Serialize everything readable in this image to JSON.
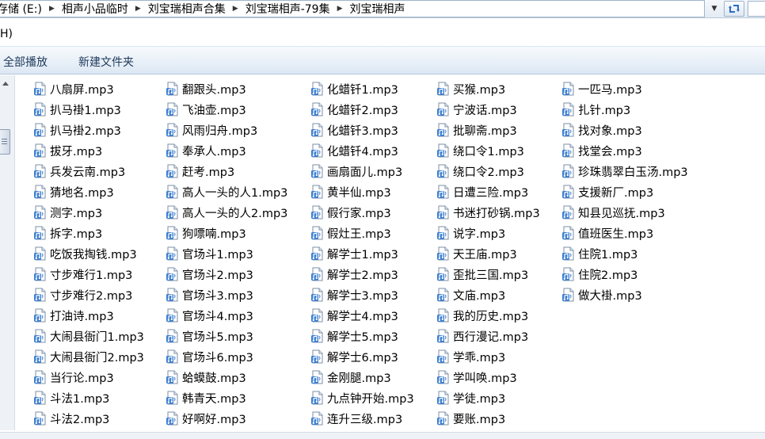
{
  "address": {
    "crumbs": [
      "存储 (E:)",
      "相声小品临时",
      "刘宝瑞相声合集",
      "刘宝瑞相声-79集",
      "刘宝瑞相声"
    ]
  },
  "menu": {
    "help_fragment": "H)"
  },
  "toolbar": {
    "play_all": "全部播放",
    "new_folder": "新建文件夹"
  },
  "icons": {
    "file": "mp3-audio-file-icon",
    "refresh": "refresh-icon",
    "dropdown": "chevron-down-icon"
  },
  "colors": {
    "accent_blue": "#2a6cc6",
    "toolbar_text": "#1e395b"
  },
  "files": {
    "col1": [
      "八扇屏.mp3",
      "扒马褂1.mp3",
      "扒马褂2.mp3",
      "拔牙.mp3",
      "兵发云南.mp3",
      "猜地名.mp3",
      "测字.mp3",
      "拆字.mp3",
      "吃饭我掏钱.mp3",
      "寸步难行1.mp3",
      "寸步难行2.mp3",
      "打油诗.mp3",
      "大闹县衙门1.mp3",
      "大闹县衙门2.mp3",
      "当行论.mp3",
      "斗法1.mp3",
      "斗法2.mp3"
    ],
    "col2": [
      "翻跟头.mp3",
      "飞油壶.mp3",
      "风雨归舟.mp3",
      "奉承人.mp3",
      "赶考.mp3",
      "高人一头的人1.mp3",
      "高人一头的人2.mp3",
      "狗嘌喃.mp3",
      "官场斗1.mp3",
      "官场斗2.mp3",
      "官场斗3.mp3",
      "官场斗4.mp3",
      "官场斗5.mp3",
      "官场斗6.mp3",
      "蛤蟆鼓.mp3",
      "韩青天.mp3",
      "好啊好.mp3"
    ],
    "col3": [
      "化蜡钎1.mp3",
      "化蜡钎2.mp3",
      "化蜡钎3.mp3",
      "化蜡钎4.mp3",
      "画扇面儿.mp3",
      "黄半仙.mp3",
      "假行家.mp3",
      "假灶王.mp3",
      "解学士1.mp3",
      "解学士2.mp3",
      "解学士3.mp3",
      "解学士4.mp3",
      "解学士5.mp3",
      "解学士6.mp3",
      "金刚腿.mp3",
      "九点钟开始.mp3",
      "连升三级.mp3"
    ],
    "col4": [
      "买猴.mp3",
      "宁波话.mp3",
      "批聊斋.mp3",
      "绕口令1.mp3",
      "绕口令2.mp3",
      "日遭三险.mp3",
      "书迷打砂锅.mp3",
      "说字.mp3",
      "天王庙.mp3",
      "歪批三国.mp3",
      "文庙.mp3",
      "我的历史.mp3",
      "西行漫记.mp3",
      "学乖.mp3",
      "学叫唤.mp3",
      "学徒.mp3",
      "要账.mp3"
    ],
    "col5": [
      "一匹马.mp3",
      "扎针.mp3",
      "找对象.mp3",
      "找堂会.mp3",
      "珍珠翡翠白玉汤.mp3",
      "支援新厂.mp3",
      "知县见巡抚.mp3",
      "值班医生.mp3",
      "住院1.mp3",
      "住院2.mp3",
      "做大褂.mp3"
    ]
  }
}
